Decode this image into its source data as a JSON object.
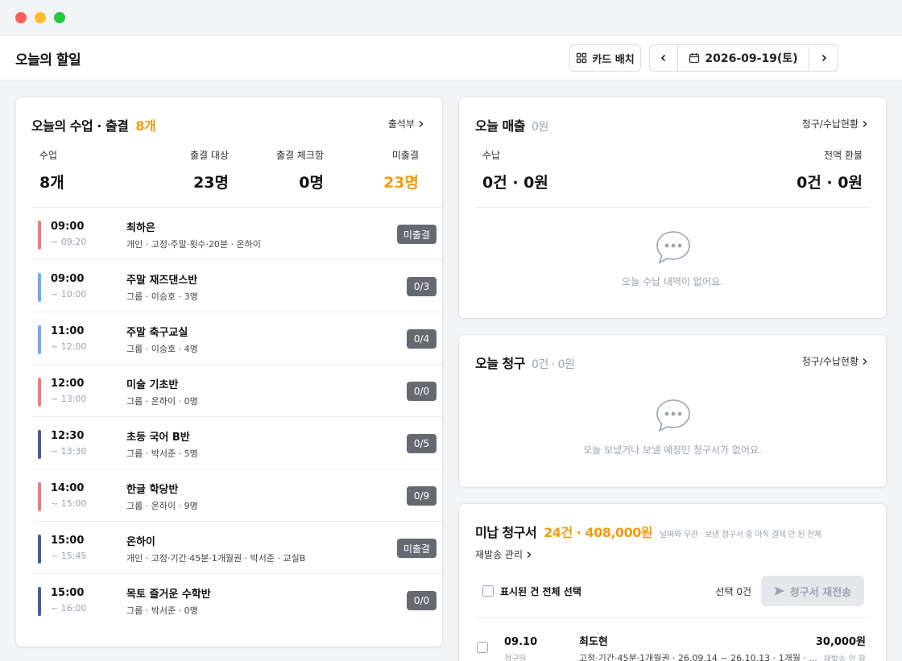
{
  "window": {
    "controls": {
      "close_color": "#ff5f57",
      "minimize_color": "#febc2e",
      "zoom_color": "#28c840"
    }
  },
  "header": {
    "title": "오늘의 할일",
    "card_layout_label": "카드 배치",
    "date": "2026-09-19(토)"
  },
  "classes_card": {
    "title": "오늘의 수업 · 출결",
    "count": "8개",
    "link": "출석부",
    "stats": {
      "classes_label": "수업",
      "classes_value": "8개",
      "target_label": "출결 대상",
      "target_value": "23명",
      "checked_label": "출결 체크함",
      "checked_value": "0명",
      "unchecked_label": "미출결",
      "unchecked_value": "23명"
    },
    "rows": [
      {
        "start": "09:00",
        "end": "~ 09:20",
        "name": "최하은",
        "desc": "개인 · 고정·주말·횟수·20분 · 온하이",
        "badge": "미출결",
        "color": "#f07b7f"
      },
      {
        "start": "09:00",
        "end": "~ 10:00",
        "name": "주말 재즈댄스반",
        "desc": "그룹 · 이승호 · 3명",
        "badge": "0/3",
        "color": "#6aaef0"
      },
      {
        "start": "11:00",
        "end": "~ 12:00",
        "name": "주말 축구교실",
        "desc": "그룹 · 이승호 · 4명",
        "badge": "0/4",
        "color": "#6aaef0"
      },
      {
        "start": "12:00",
        "end": "~ 13:00",
        "name": "미술 기초반",
        "desc": "그룹 · 온하이 · 0명",
        "badge": "0/0",
        "color": "#f07b7f"
      },
      {
        "start": "12:30",
        "end": "~ 13:30",
        "name": "초등 국어 B반",
        "desc": "그룹 · 박서준 · 5명",
        "badge": "0/5",
        "color": "#4a5a9c"
      },
      {
        "start": "14:00",
        "end": "~ 15:00",
        "name": "한글 학당반",
        "desc": "그룹 · 온하이 · 9명",
        "badge": "0/9",
        "color": "#f07b7f"
      },
      {
        "start": "15:00",
        "end": "~ 15:45",
        "name": "온하이",
        "desc": "개인 · 고정·기간·45분·1개월권 · 박서준 · 교실B",
        "badge": "미출결",
        "color": "#4a5a9c"
      },
      {
        "start": "15:00",
        "end": "~ 16:00",
        "name": "목토 즐거운 수학반",
        "desc": "그룹 · 박서준 · 0명",
        "badge": "0/0",
        "color": "#4a5a9c"
      }
    ]
  },
  "sales_card": {
    "title": "오늘 매출",
    "amount": "0원",
    "link": "청구/수납현황",
    "received_label": "수납",
    "received_value": "0건 · 0원",
    "refund_label": "전액 환불",
    "refund_value": "0건 · 0원",
    "empty_text": "오늘 수납 내역이 없어요."
  },
  "invoice_card": {
    "title": "오늘 청구",
    "count": "0건 · 0원",
    "link": "청구/수납현황",
    "empty_text": "오늘 보냈거나 보낼 예정인 청구서가 없어요."
  },
  "unpaid_card": {
    "title": "미납 청구서",
    "summary": "24건 · 408,000원",
    "hint": "날짜와 무관 · 보낸 청구서 중 아직 결제 안 된 전체",
    "resend_manage": "재발송 관리",
    "select_all": "표시된 건 전체 선택",
    "selected_count": "선택 0건",
    "resend_button": "청구서 재전송",
    "item": {
      "date": "09.10",
      "date_label": "청구일",
      "name": "최도현",
      "desc": "고정·기간·45분·1개월권 · 26.09.14 ~ 26.10.13 · 1개월 · ...",
      "amount": "30,000원",
      "status": "재발송 안 함"
    }
  }
}
